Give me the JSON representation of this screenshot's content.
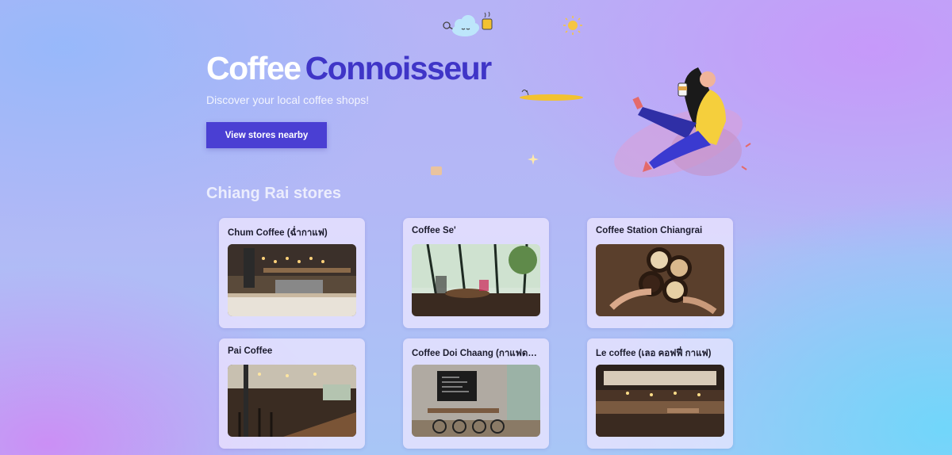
{
  "hero": {
    "title_part1": "Coffee",
    "title_part2": "Connoisseur",
    "subtitle": "Discover your local coffee shops!",
    "cta_label": "View stores nearby"
  },
  "section": {
    "title": "Chiang Rai stores"
  },
  "stores": [
    {
      "name": "Chum Coffee (ฉ่ำกาแฟ)",
      "image": "coffee-bar-interior"
    },
    {
      "name": "Coffee Se'",
      "image": "window-table-interior"
    },
    {
      "name": "Coffee Station Chiangrai",
      "image": "latte-cups-toast"
    },
    {
      "name": "Pai Coffee",
      "image": "long-table-cafe"
    },
    {
      "name": "Coffee Doi Chaang (กาแฟดอยช้าง)",
      "image": "bikes-blackboard-cafe"
    },
    {
      "name": "Le coffee (เลอ คอฟฟี่ กาแฟ)",
      "image": "counter-cafe-interior"
    }
  ],
  "colors": {
    "accent": "#4a3fd3",
    "title_dark": "#3f35c7",
    "card_bg": "#f0e8ff"
  },
  "icons": [
    "cloud-icon",
    "sun-icon",
    "coffee-cup-icon",
    "sparkle-icon",
    "person-drinking-coffee-illustration"
  ]
}
